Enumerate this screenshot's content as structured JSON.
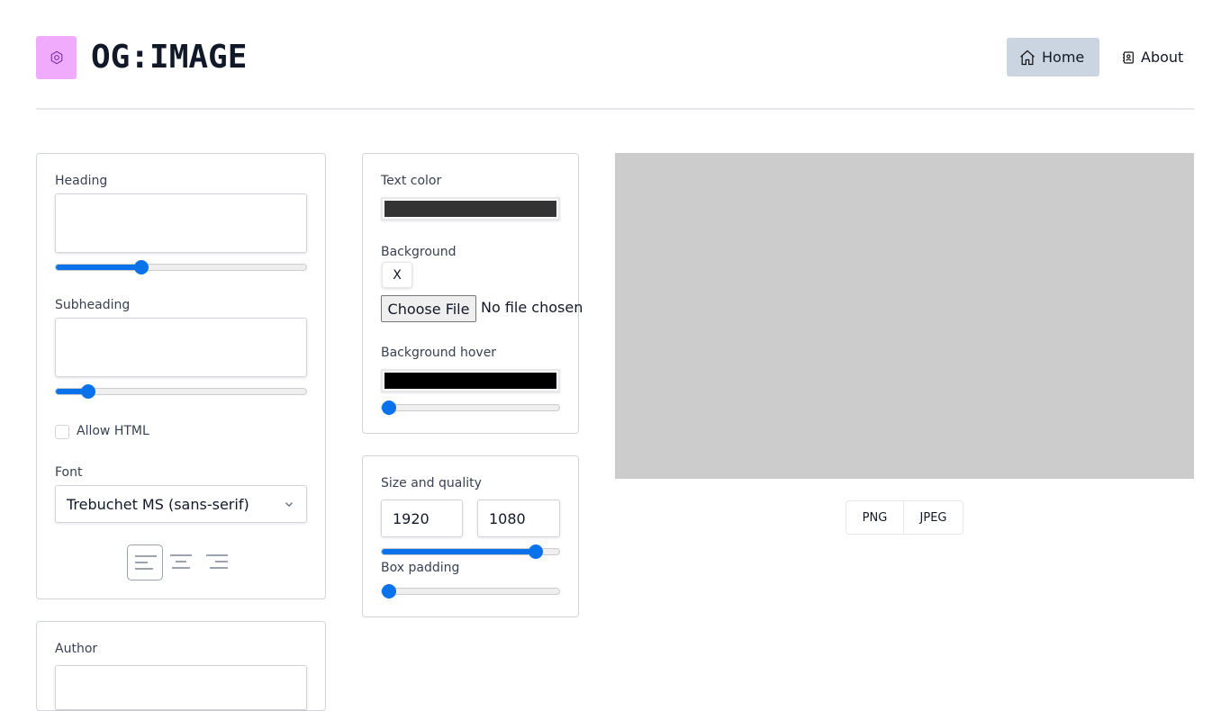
{
  "header": {
    "title": "OG:IMAGE",
    "nav": [
      {
        "label": "Home",
        "icon": "home-icon"
      },
      {
        "label": "About",
        "icon": "contact-icon"
      }
    ]
  },
  "left": {
    "heading_label": "Heading",
    "heading_value": "",
    "heading_size": 0.34,
    "subheading_label": "Subheading",
    "subheading_value": "",
    "subheading_size": 0.13,
    "allow_html_label": "Allow HTML",
    "allow_html": false,
    "font_label": "Font",
    "font_value": "Trebuchet MS (sans-serif)",
    "align_selected": "left",
    "author_label": "Author"
  },
  "mid": {
    "text_color_label": "Text color",
    "text_color": "#333333",
    "background_label": "Background",
    "clear_label": "X",
    "choose_file_label": "Choose File",
    "no_file_label": "No file chosen",
    "bg_hover_label": "Background hover",
    "bg_hover_color": "#000000",
    "bg_hover_opacity": 0,
    "size_label": "Size and quality",
    "width": "1920",
    "height": "1080",
    "quality": 0.87,
    "padding_label": "Box padding",
    "padding": 0
  },
  "preview": {
    "bg": "#cccccc",
    "formats": [
      "PNG",
      "JPEG"
    ]
  }
}
